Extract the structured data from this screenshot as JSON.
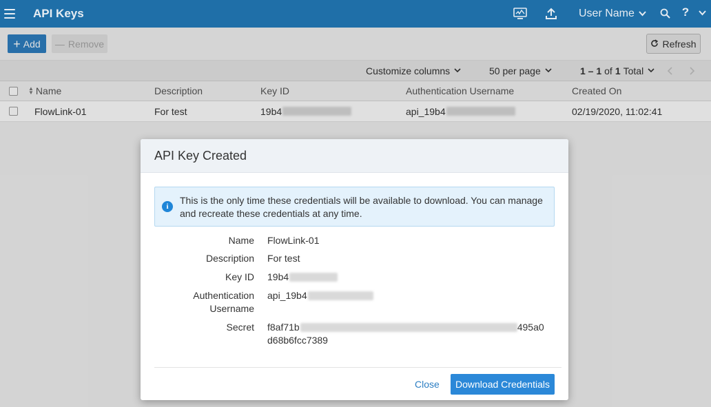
{
  "app": {
    "title": "API Keys",
    "user_name": "User Name"
  },
  "toolbar": {
    "add_label": "Add",
    "remove_label": "Remove",
    "refresh_label": "Refresh"
  },
  "pager": {
    "customize_columns": "Customize columns",
    "per_page": "50 per page",
    "range": "1 – 1",
    "of": "of",
    "total_count": "1",
    "total_label": "Total"
  },
  "table": {
    "columns": [
      "Name",
      "Description",
      "Key ID",
      "Authentication Username",
      "Created On"
    ],
    "rows": [
      {
        "name": "FlowLink-01",
        "description": "For test",
        "key_id": "19b4",
        "auth_username": "api_19b4",
        "created_on": "02/19/2020, 11:02:41"
      }
    ]
  },
  "modal": {
    "title": "API Key Created",
    "alert": "This is the only time these credentials will be available to download. You can manage and recreate these credentials at any time.",
    "fields": {
      "name_label": "Name",
      "name_value": "FlowLink-01",
      "description_label": "Description",
      "description_value": "For test",
      "key_id_label": "Key ID",
      "key_id_value": "19b4",
      "auth_label_1": "Authentication",
      "auth_label_2": "Username",
      "auth_value": "api_19b4",
      "secret_label": "Secret",
      "secret_line1_start": "f8af71b",
      "secret_line1_end": "495a0",
      "secret_line2": "d68b6fcc7389"
    },
    "close_label": "Close",
    "download_label": "Download Credentials"
  },
  "colors": {
    "topbar": "#1f6fa8",
    "primary_button": "#2b88d8",
    "link": "#2c7ec3",
    "info_bg": "#e4f2fc"
  },
  "icons": [
    "menu-icon",
    "monitor-icon",
    "upload-icon",
    "chevron-down-icon",
    "search-icon",
    "help-icon",
    "plus-icon",
    "minus-icon",
    "refresh-icon",
    "sort-icon",
    "info-icon"
  ]
}
